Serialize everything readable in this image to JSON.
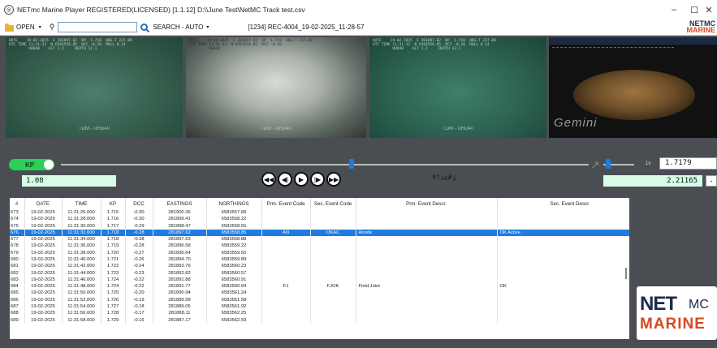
{
  "window": {
    "title": "NETmc Marine Player REGISTERED(LICENSED) [1.1.12] D:\\\\June Test\\NetMC Track test.csv",
    "minimize": "–",
    "maximize": "☐",
    "close": "✕"
  },
  "toolbar": {
    "open_label": "OPEN",
    "search_mode": "SEARCH - AUTO",
    "file_label": "[1234] REC-4004_19-02-2025_11-28-57",
    "search_value": ""
  },
  "logo": {
    "line1": "NETMC",
    "line2": "MARINE"
  },
  "videos": {
    "cam1": {
      "overlay": "DATE    19-02-2025  E 281897.62  KP  1.718  HDG-T 237.89\nUTC TIME 11:31:32  N 6583558.85  DCC -0.28  ROLL 0.14\n         UHD40    ALT 1.2     DEPTH 12.1",
      "label": "TDM - UHD40"
    },
    "cam2": {
      "overlay": "DATE    19-02-2025  E 281897.62  KP  1.718  HDG-T 237.89\nUTC TIME 11:31:32  N 6583558.85  DCC -0.28\n         UHD40",
      "label": "TDM - UHD40"
    },
    "cam3": {
      "overlay": "DATE    19-02-2025  E 281897.62  KP  1.718  HDG-T 237.89\nUTC TIME 11:31:32  N 6583558.85  DCC -0.28  ROLL 0.14\n         UHD40    ALT 1.2     DEPTH 12.1",
      "label": "TDM - UHD40"
    },
    "sonar": {
      "brand": "Gemini"
    }
  },
  "controls": {
    "kp_label": "KP",
    "kp_position": 0.55,
    "kp_value": "1.08",
    "speed_unit": "1x",
    "speed_value": "1.7179",
    "dcc_value": "2.21165",
    "small_button": "-",
    "heading_e1": "E",
    "heading_e2": "E",
    "heading_value": "143"
  },
  "table": {
    "columns": [
      "#",
      "DATE",
      "TIME",
      "KP",
      "DCC",
      "EASTINGS",
      "NORTHINGS",
      "Prm. Event Code",
      "Sec. Event Code",
      "Prm. Event Descr.",
      "Sec. Event Descr."
    ],
    "rows": [
      [
        "673",
        "19-02-2025",
        "11:31:26.000",
        "1.715",
        "-0.30",
        "281900.36",
        "6583557.89",
        "",
        "",
        "",
        ""
      ],
      [
        "674",
        "19-02-2025",
        "11:31:28.000",
        "1.716",
        "-0.30",
        "281899.41",
        "6583558.22",
        "",
        "",
        "",
        ""
      ],
      [
        "675",
        "19-02-2025",
        "11:31:30.000",
        "1.717",
        "-0.29",
        "281898.47",
        "6583558.55",
        "",
        "",
        "",
        ""
      ],
      [
        "676",
        "19-02-2025",
        "11:31:32.000",
        "1.718",
        "-0.28",
        "281897.62",
        "6583558.85",
        "AN",
        "OKAC",
        "Anode",
        "OK Active"
      ],
      [
        "677",
        "19-02-2025",
        "11:31:34.000",
        "1.718",
        "-0.28",
        "281897.53",
        "6583558.88",
        "",
        "",
        "",
        ""
      ],
      [
        "678",
        "19-02-2025",
        "11:31:36.000",
        "1.719",
        "-0.28",
        "281896.58",
        "6583559.22",
        "",
        "",
        "",
        ""
      ],
      [
        "679",
        "19-02-2025",
        "11:31:38.000",
        "1.720",
        "-0.27",
        "281895.64",
        "6583559.55",
        "",
        "",
        "",
        ""
      ],
      [
        "680",
        "19-02-2025",
        "11:31:40.000",
        "1.721",
        "-0.26",
        "281894.70",
        "6583559.89",
        "",
        "",
        "",
        ""
      ],
      [
        "681",
        "19-02-2025",
        "11:31:42.000",
        "1.722",
        "-0.24",
        "281893.76",
        "6583560.23",
        "",
        "",
        "",
        ""
      ],
      [
        "682",
        "19-02-2025",
        "11:31:44.000",
        "1.723",
        "-0.23",
        "281892.82",
        "6583560.57",
        "",
        "",
        "",
        ""
      ],
      [
        "683",
        "19-02-2025",
        "11:31:46.000",
        "1.724",
        "-0.22",
        "281891.88",
        "6583560.91",
        "",
        "",
        "",
        ""
      ],
      [
        "684",
        "19-02-2025",
        "11:31:48.000",
        "1.724",
        "-0.22",
        "281891.77",
        "6583560.94",
        "FJ",
        "FJOK",
        "Field Joint",
        "OK"
      ],
      [
        "685",
        "19-02-2025",
        "11:31:50.000",
        "1.725",
        "-0.20",
        "281890.94",
        "6583561.24",
        "",
        "",
        "",
        ""
      ],
      [
        "686",
        "19-02-2025",
        "11:31:52.000",
        "1.726",
        "-0.19",
        "281889.99",
        "6583561.58",
        "",
        "",
        "",
        ""
      ],
      [
        "687",
        "19-02-2025",
        "11:31:54.000",
        "1.727",
        "-0.18",
        "281889.05",
        "6583561.92",
        "",
        "",
        "",
        ""
      ],
      [
        "688",
        "19-02-2025",
        "11:31:56.000",
        "1.728",
        "-0.17",
        "281888.11",
        "6583562.25",
        "",
        "",
        "",
        ""
      ],
      [
        "689",
        "19-02-2025",
        "11:31:58.000",
        "1.729",
        "-0.16",
        "281887.17",
        "6583562.59",
        "",
        "",
        "",
        ""
      ]
    ],
    "selected_index": 3
  }
}
